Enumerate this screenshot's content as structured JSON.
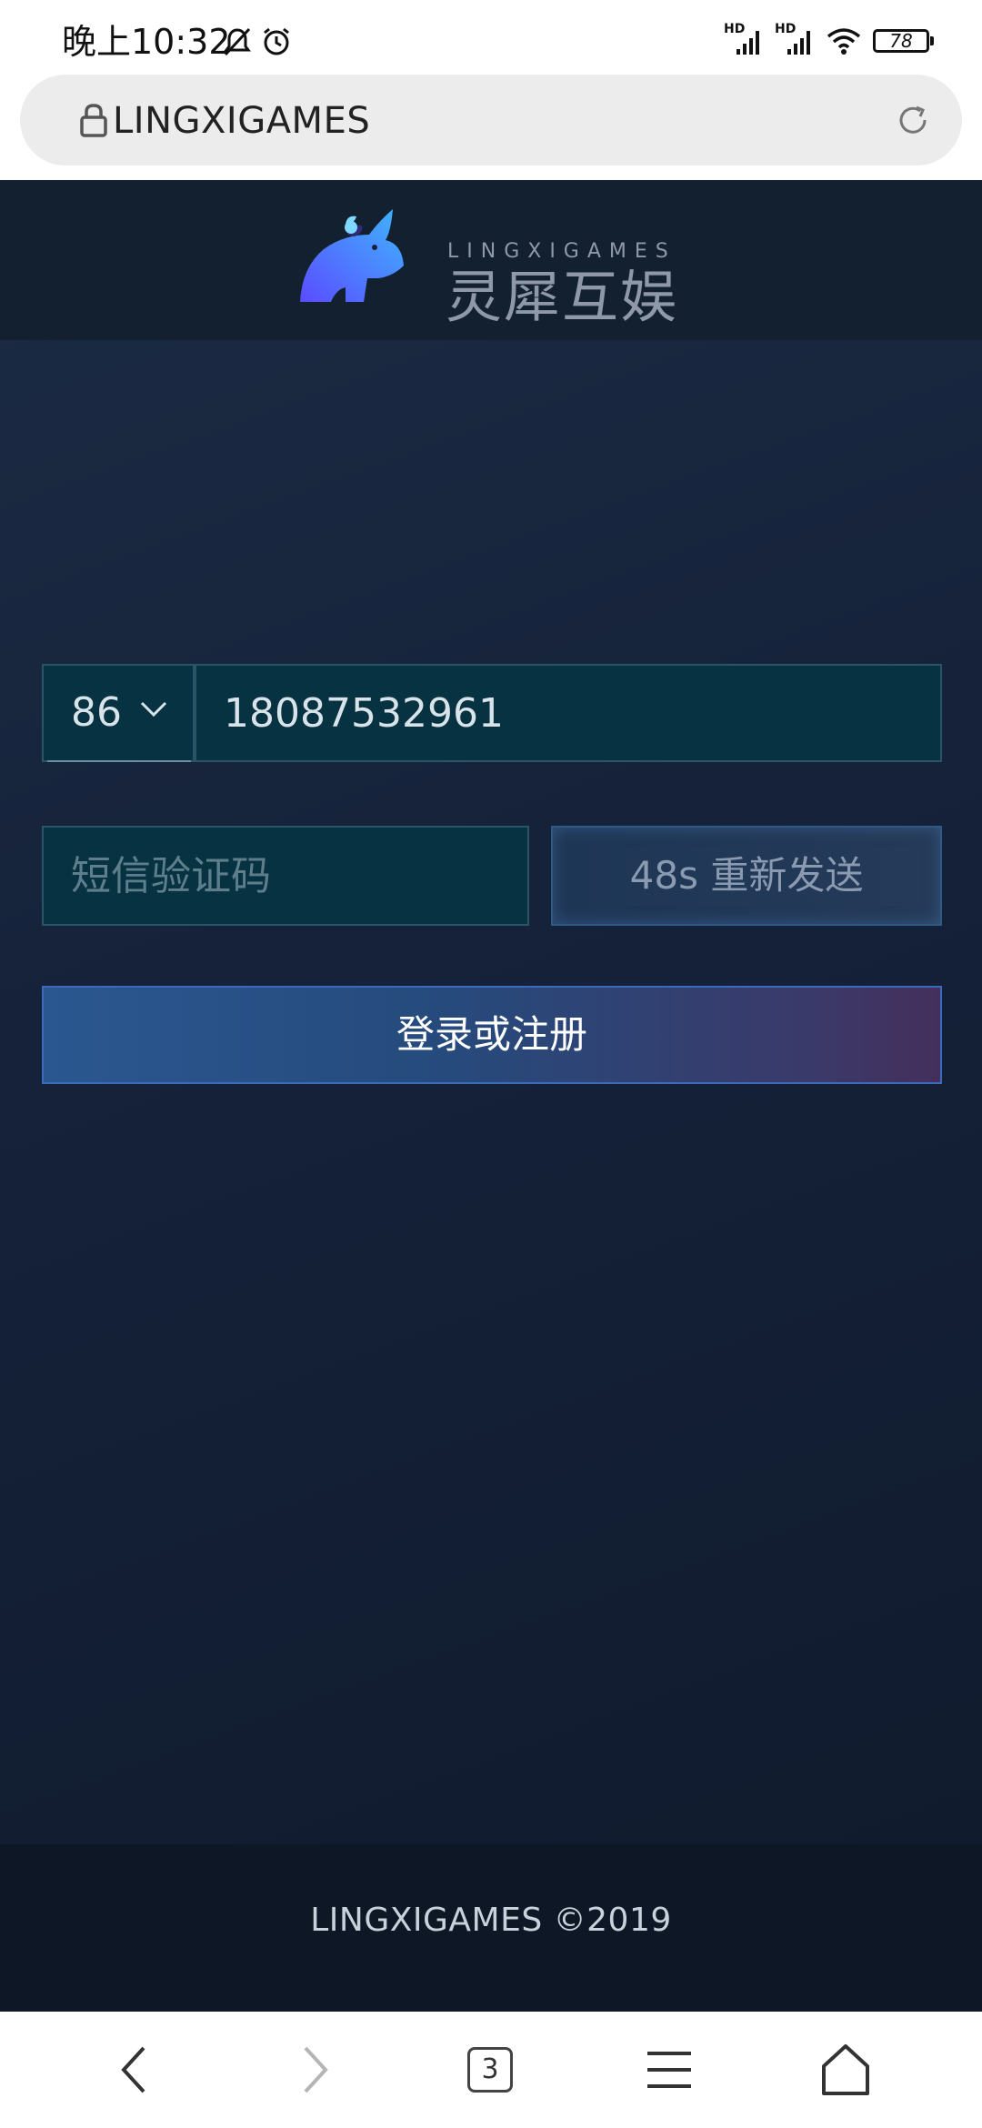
{
  "status_bar": {
    "time": "晚上10:32",
    "battery": "78",
    "signal_label_1": "HD",
    "signal_label_2": "HD"
  },
  "browser": {
    "url": "LINGXIGAMES",
    "tab_count": "3"
  },
  "header": {
    "logo_en": "LINGXIGAMES",
    "logo_cn": "灵犀互娱"
  },
  "form": {
    "country_code": "86",
    "phone_value": "18087532961",
    "code_placeholder": "短信验证码",
    "resend_label": "48s 重新发送",
    "login_label": "登录或注册"
  },
  "footer": {
    "copyright": "LINGXIGAMES ©2019"
  },
  "colors": {
    "background": "#15223a",
    "input_bg": "#073241",
    "accent_border": "#3c6bbd"
  }
}
